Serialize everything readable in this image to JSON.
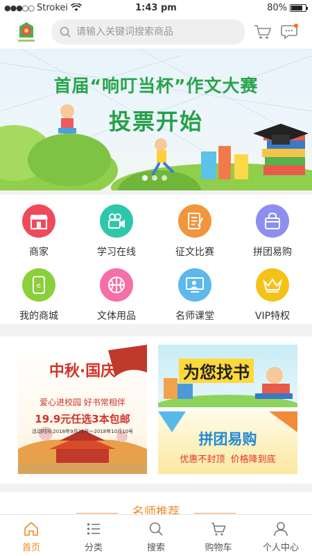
{
  "status_bar": {
    "carrier": "Strokei",
    "time": "1:43 pm",
    "battery": "80%"
  },
  "header": {
    "search_placeholder": "请输入关键词搜索商品",
    "icons": [
      "logo",
      "search-icon",
      "cart-icon",
      "message-icon"
    ]
  },
  "banner": {
    "title": "首届“响叮当杯”作文大赛",
    "subtitle": "投票开始",
    "pages": 3,
    "active_page": 0
  },
  "categories": [
    {
      "label": "商家",
      "color": "#f04a5a",
      "icon": "store-icon"
    },
    {
      "label": "学习在线",
      "color": "#2fc7a9",
      "icon": "video-icon"
    },
    {
      "label": "征文比赛",
      "color": "#f3953a",
      "icon": "document-icon"
    },
    {
      "label": "拼团易购",
      "color": "#8e8ef0",
      "icon": "bag-icon"
    },
    {
      "label": "我的商城",
      "color": "#8bcf3a",
      "icon": "phone-shop-icon"
    },
    {
      "label": "文体用品",
      "color": "#f56fa8",
      "icon": "basketball-icon"
    },
    {
      "label": "名师课堂",
      "color": "#5db8ec",
      "icon": "teacher-icon"
    },
    {
      "label": "VIP特权",
      "color": "#f5c217",
      "icon": "crown-icon"
    }
  ],
  "promos": {
    "festival": {
      "title": "中秋·国庆",
      "slogan": "爱心进校园 好书常相伴",
      "offer": "19.9元任选3本包邮",
      "dates": "活动时间:2018年9月21号～2018年10月10号"
    },
    "find_book": {
      "title": "为您找书"
    },
    "group_buy": {
      "title": "拼团易购",
      "subtitle": "优惠不封顶  价格降到底"
    }
  },
  "section": {
    "title": "名师推荐"
  },
  "tabbar": [
    {
      "label": "首页",
      "icon": "home-icon",
      "active": true
    },
    {
      "label": "分类",
      "icon": "category-icon",
      "active": false
    },
    {
      "label": "搜索",
      "icon": "search-icon",
      "active": false
    },
    {
      "label": "购物车",
      "icon": "cart-icon",
      "active": false
    },
    {
      "label": "个人中心",
      "icon": "user-icon",
      "active": false
    }
  ],
  "colors": {
    "accent": "#f08a24",
    "banner_green": "#27a44a"
  }
}
